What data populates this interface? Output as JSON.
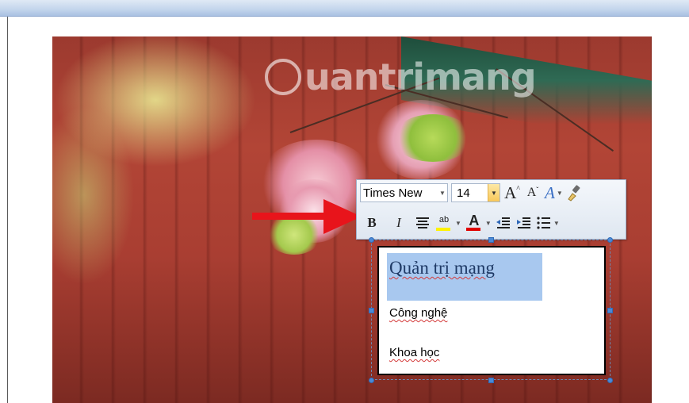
{
  "watermark": "uantrimang",
  "toolbar": {
    "font_name": "Times New",
    "font_size": "14",
    "grow_font_label": "A",
    "shrink_font_label": "A",
    "styles_label": "A",
    "bold_label": "B",
    "italic_label": "I",
    "highlight_label": "ab",
    "font_color_label": "A",
    "highlight_color": "#fff200",
    "font_color": "#e00000"
  },
  "textbox": {
    "line1": "Quản trị mạng",
    "line2": "Công nghệ",
    "line3": "Khoa học"
  },
  "colors": {
    "arrow": "#e8141b",
    "selection": "#a8c8ef"
  }
}
